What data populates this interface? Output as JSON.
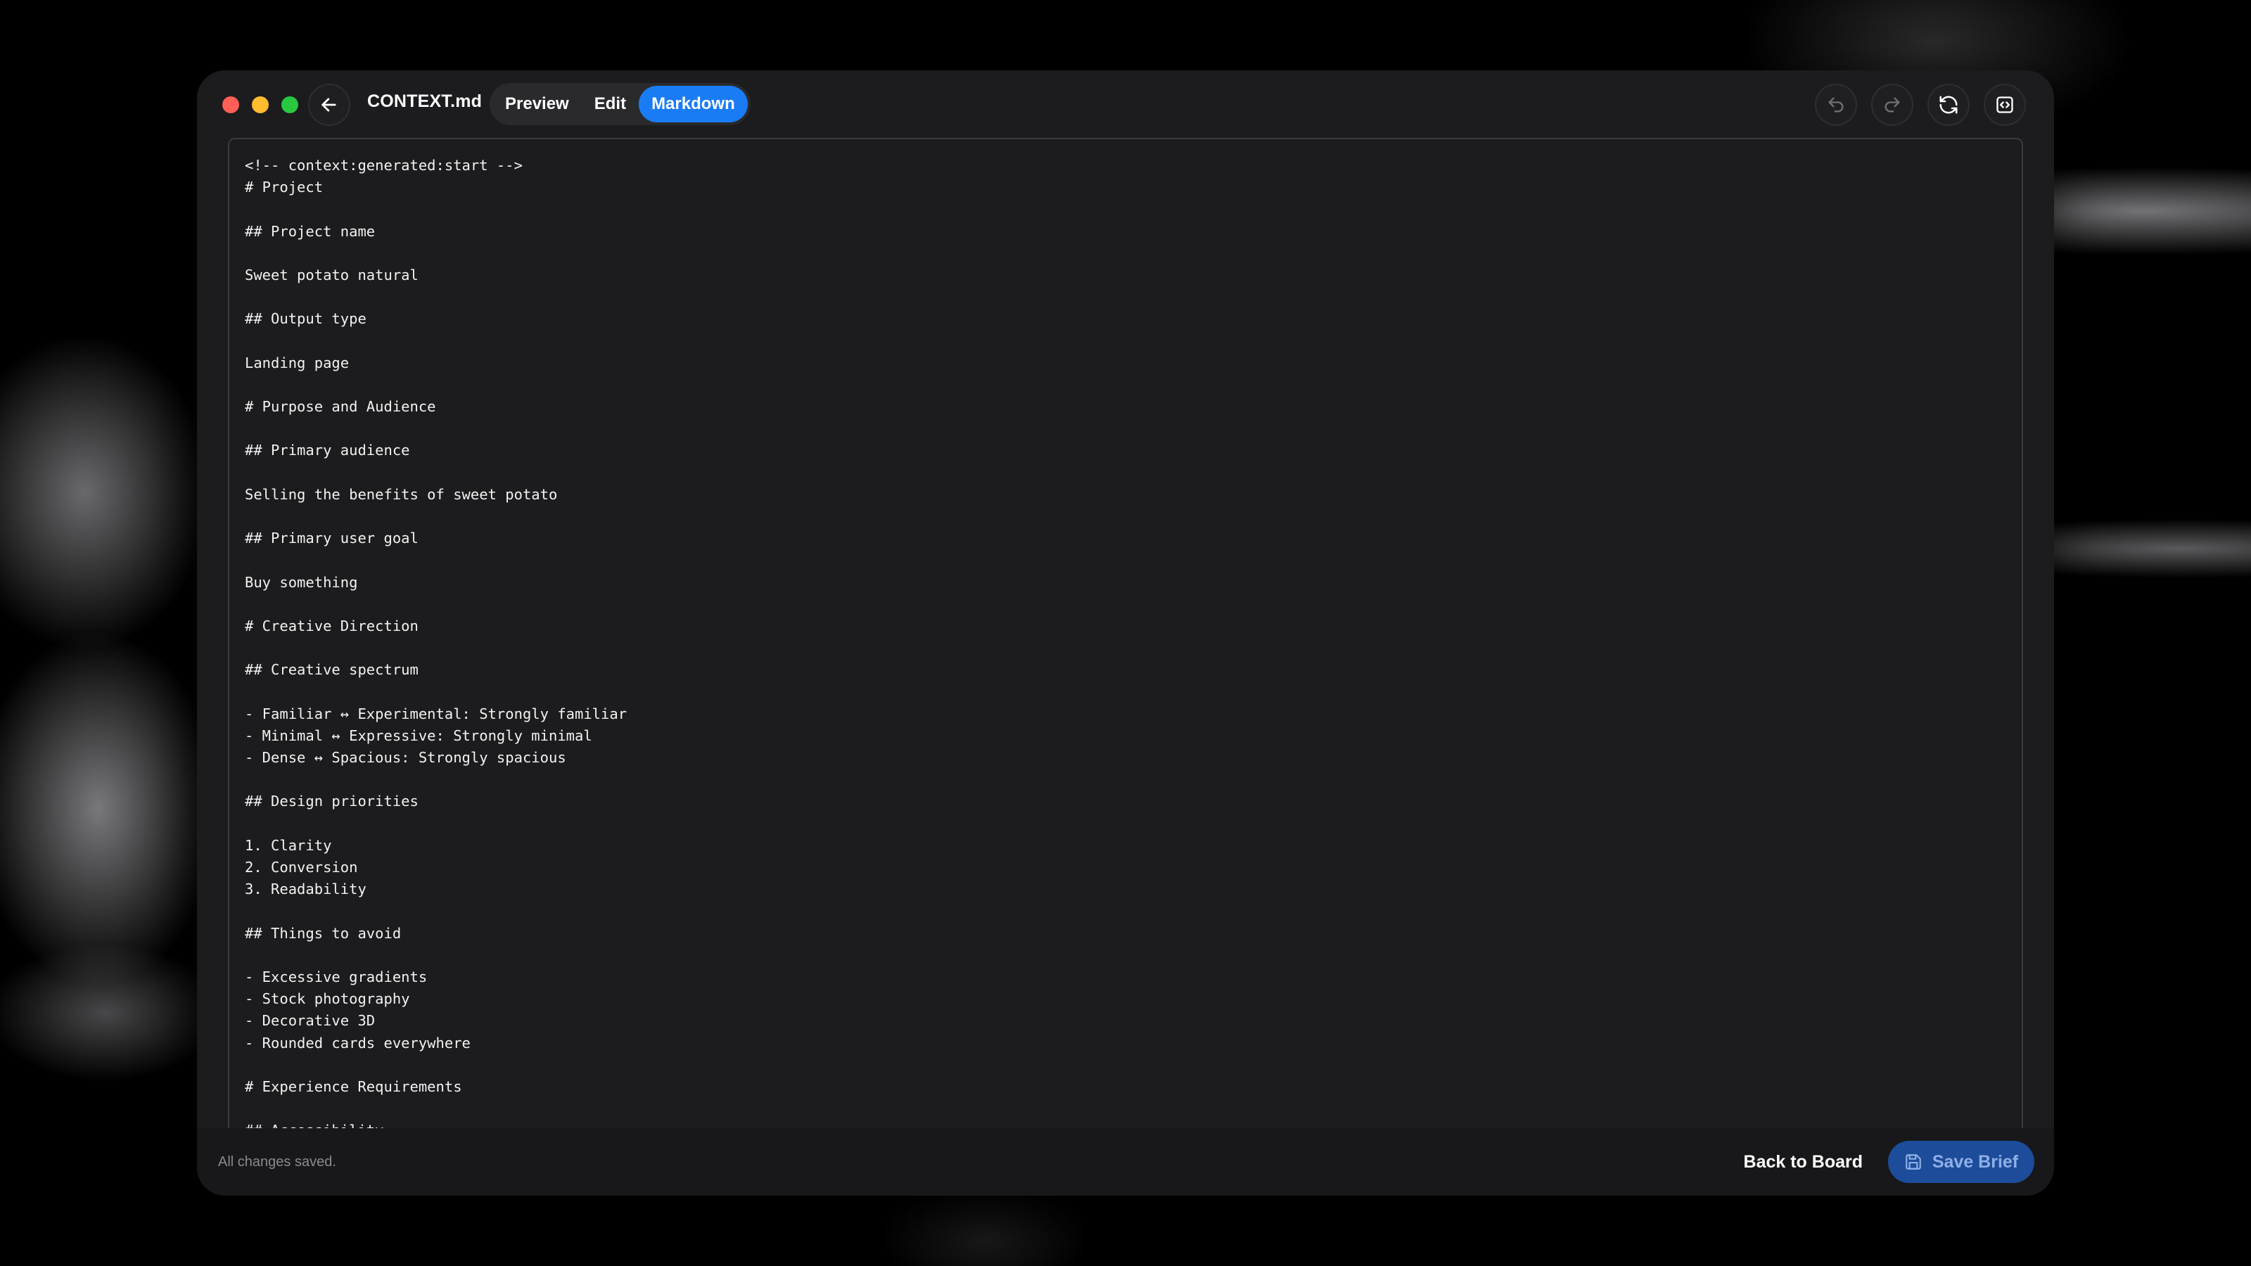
{
  "header": {
    "filename": "CONTEXT.md",
    "tabs": [
      {
        "label": "Preview",
        "active": false
      },
      {
        "label": "Edit",
        "active": false
      },
      {
        "label": "Markdown",
        "active": true
      }
    ],
    "icons": [
      "undo-icon",
      "redo-icon",
      "refresh-icon",
      "code-panel-icon"
    ]
  },
  "editor": {
    "lines": [
      "<!-- context:generated:start -->",
      "# Project",
      "",
      "## Project name",
      "",
      "Sweet potato natural",
      "",
      "## Output type",
      "",
      "Landing page",
      "",
      "# Purpose and Audience",
      "",
      "## Primary audience",
      "",
      "Selling the benefits of sweet potato",
      "",
      "## Primary user goal",
      "",
      "Buy something",
      "",
      "# Creative Direction",
      "",
      "## Creative spectrum",
      "",
      "- Familiar ↔ Experimental: Strongly familiar",
      "- Minimal ↔ Expressive: Strongly minimal",
      "- Dense ↔ Spacious: Strongly spacious",
      "",
      "## Design priorities",
      "",
      "1. Clarity",
      "2. Conversion",
      "3. Readability",
      "",
      "## Things to avoid",
      "",
      "- Excessive gradients",
      "- Stock photography",
      "- Decorative 3D",
      "- Rounded cards everywhere",
      "",
      "# Experience Requirements",
      "",
      "## Accessibility"
    ]
  },
  "footer": {
    "status": "All changes saved.",
    "back_label": "Back to Board",
    "save_label": "Save Brief"
  },
  "colors": {
    "accent": "#1a7cf5",
    "save_button": "#1c4c9a",
    "window_bg": "#1c1c1e"
  }
}
